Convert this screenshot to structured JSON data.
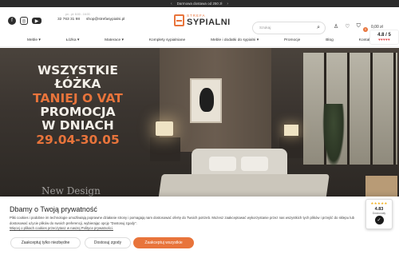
{
  "promo_bar": {
    "text": "Darmowa dostawa od 250 zł",
    "prev": "‹",
    "next": "›"
  },
  "header": {
    "social": [
      {
        "name": "facebook-icon",
        "glyph": "f"
      },
      {
        "name": "instagram-icon",
        "glyph": "◎"
      },
      {
        "name": "youtube-icon",
        "glyph": "▶"
      }
    ],
    "hours": "pn - pt: 8:00 - 16:00",
    "phone": "32 763 31 98",
    "email": "shop@strefasypialni.pl",
    "logo_small": "STREFA",
    "logo_big": "SYPIALNI",
    "search_placeholder": "Szukaj",
    "cart_count": "0",
    "cart_total": "0,00 zł"
  },
  "nav": {
    "items": [
      "Meble ▾",
      "Łóżka ▾",
      "Materace ▾",
      "Komplety sypialniane",
      "Meble i dodatki do sypialni ▾",
      "Promocje",
      "Blog",
      "Kontakt"
    ]
  },
  "hero": {
    "line1": "WSZYSTKIE",
    "line2": "ŁÓŻKA",
    "line3": "TANIEJ O VAT",
    "line4": "PROMOCJA",
    "line5": "W DNIACH",
    "line6": "29.04-30.05",
    "watermark": "New Design"
  },
  "rating": {
    "score": "4.8 / 5",
    "hearts": "♥♥♥♥♥",
    "stars_fill": 4.8
  },
  "cookie": {
    "title": "Dbamy o Twoją prywatność",
    "text": "Pliki cookies i podobne im technologie umożliwiają poprawne działanie strony i pomagają nam dostosować ofertę do Twoich potrzeb. Możesz zaakceptować wykorzystanie przez nas wszystkich tych plików i przejść do sklepu lub dostosować użycie plików do swoich preferencji, wybierając opcję \"Dostosuj zgody\".",
    "link": "Więcej o plikach cookies przeczytasz w naszej Polityce prywatności.",
    "btn_necessary": "Zaakceptuj tylko niezbędne",
    "btn_customize": "Dostosuj zgody",
    "btn_accept_all": "Zaakceptuj wszystkie"
  },
  "trust_badge": {
    "stars": "★★★★★",
    "score": "4.83",
    "label": "Doskonały",
    "logo_glyph": "✓"
  },
  "colors": {
    "accent": "#e8743b",
    "dark": "#2b2b2b"
  }
}
